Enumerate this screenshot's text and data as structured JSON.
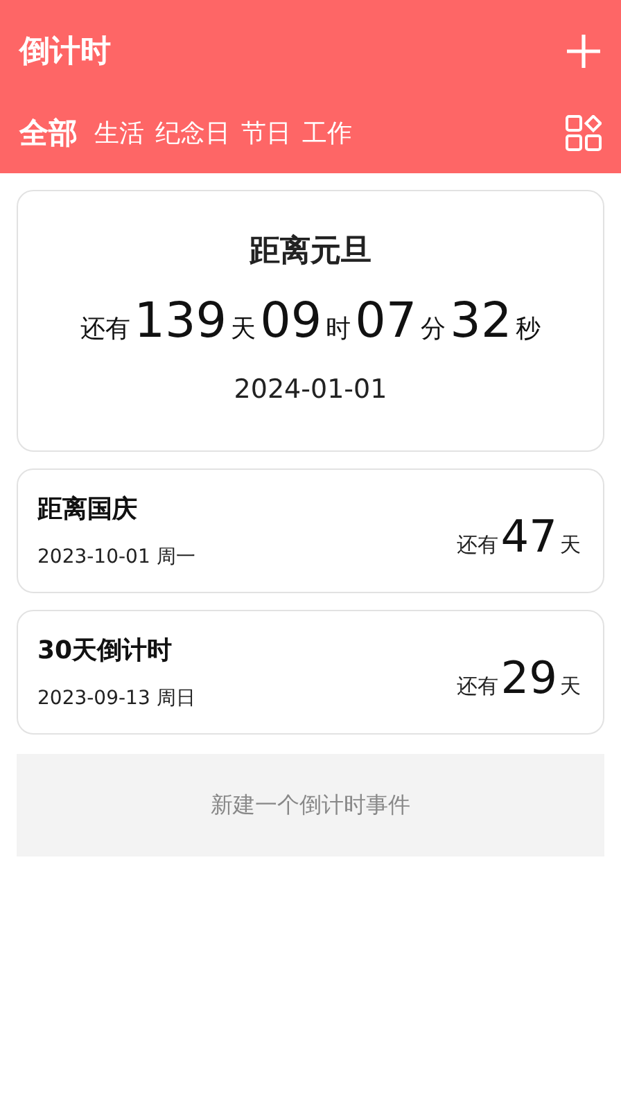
{
  "header": {
    "title": "倒计时"
  },
  "tabs": [
    {
      "label": "全部",
      "selected": true
    },
    {
      "label": "生活",
      "selected": false
    },
    {
      "label": "纪念日",
      "selected": false
    },
    {
      "label": "节日",
      "selected": false
    },
    {
      "label": "工作",
      "selected": false
    }
  ],
  "featured": {
    "title": "距离元旦",
    "prefix": "还有",
    "parts": [
      {
        "value": "139",
        "unit": "天"
      },
      {
        "value": "09",
        "unit": "时"
      },
      {
        "value": "07",
        "unit": "分"
      },
      {
        "value": "32",
        "unit": "秒"
      }
    ],
    "date": "2024-01-01"
  },
  "events": [
    {
      "title": "距离国庆",
      "date": "2023-10-01 周一",
      "prefix": "还有",
      "value": "47",
      "unit": "天"
    },
    {
      "title": "30天倒计时",
      "date": "2023-09-13 周日",
      "prefix": "还有",
      "value": "29",
      "unit": "天"
    }
  ],
  "new_event_button": "新建一个倒计时事件"
}
